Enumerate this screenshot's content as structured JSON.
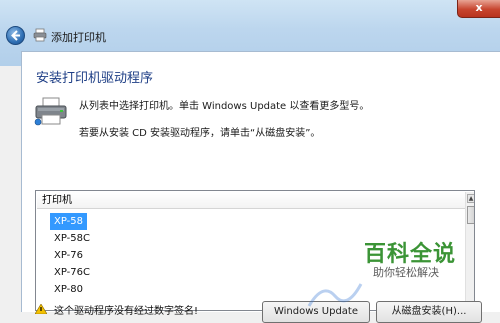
{
  "window": {
    "title": "添加打印机",
    "close_glyph": "x"
  },
  "heading": "安装打印机驱动程序",
  "description": {
    "line1": "从列表中选择打印机。单击 Windows Update 以查看更多型号。",
    "line2": "若要从安装 CD 安装驱动程序，请单击“从磁盘安装”。"
  },
  "printer_list": {
    "header": "打印机",
    "items": [
      "XP-58",
      "XP-58C",
      "XP-76",
      "XP-76C",
      "XP-80"
    ],
    "selected": "XP-58"
  },
  "footer": {
    "warning": "这个驱动程序没有经过数字签名!",
    "windows_update_label": "Windows Update",
    "have_disk_label": "从磁盘安装(H)..."
  },
  "watermark": {
    "title": "百科全说",
    "subtitle": "助你轻松解决"
  },
  "colors": {
    "heading": "#1f3f86",
    "selection": "#3399ff",
    "watermark_green": "#3b9436",
    "close_red": "#c7452f"
  },
  "icons": [
    "back-arrow-icon",
    "printer-icon",
    "warning-icon",
    "scroll-up-icon"
  ]
}
